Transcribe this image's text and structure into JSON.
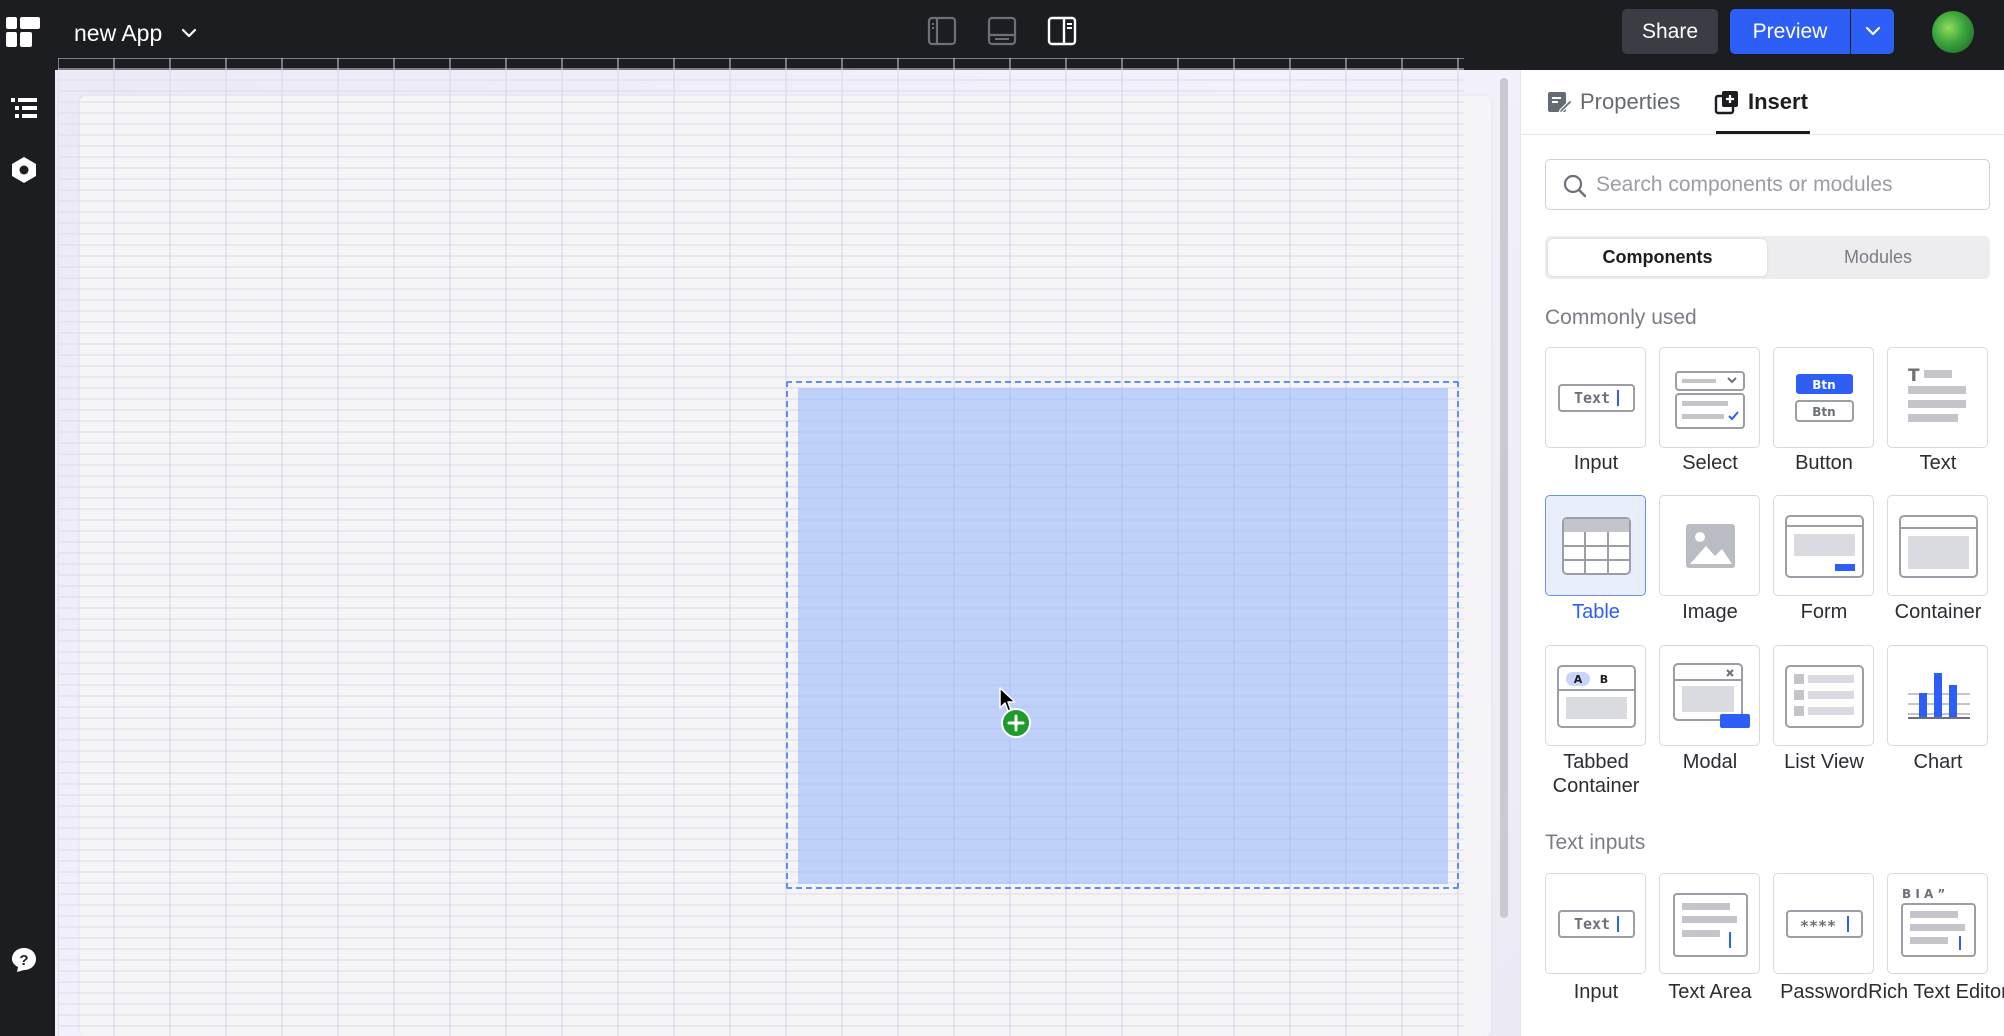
{
  "app": {
    "name": "new App"
  },
  "header": {
    "share_label": "Share",
    "preview_label": "Preview"
  },
  "panel": {
    "tabs": [
      {
        "label": "Properties"
      },
      {
        "label": "Insert"
      }
    ],
    "search": {
      "placeholder": "Search components or modules",
      "value": ""
    },
    "segments": [
      {
        "label": "Components"
      },
      {
        "label": "Modules"
      }
    ],
    "sections": [
      {
        "title": "Commonly used",
        "items": [
          {
            "label": "Input",
            "icon": "input-icon"
          },
          {
            "label": "Select",
            "icon": "select-icon"
          },
          {
            "label": "Button",
            "icon": "button-icon"
          },
          {
            "label": "Text",
            "icon": "text-icon"
          },
          {
            "label": "Table",
            "icon": "table-icon",
            "selected": true
          },
          {
            "label": "Image",
            "icon": "image-icon"
          },
          {
            "label": "Form",
            "icon": "form-icon"
          },
          {
            "label": "Container",
            "icon": "container-icon"
          },
          {
            "label": "Tabbed Container",
            "icon": "tabbed-container-icon"
          },
          {
            "label": "Modal",
            "icon": "modal-icon"
          },
          {
            "label": "List View",
            "icon": "list-view-icon"
          },
          {
            "label": "Chart",
            "icon": "chart-icon"
          }
        ]
      },
      {
        "title": "Text inputs",
        "items": [
          {
            "label": "Input",
            "icon": "text-input-icon"
          },
          {
            "label": "Text Area",
            "icon": "text-area-icon"
          },
          {
            "label": "Password",
            "icon": "password-icon"
          },
          {
            "label": "Rich Text Editor",
            "icon": "rich-text-editor-icon"
          }
        ]
      }
    ],
    "icon_texts": {
      "input": "Text",
      "button_primary": "Btn",
      "button_secondary": "Btn",
      "tab_a": "A",
      "tab_b": "B",
      "password": "****",
      "rte_toolbar": "B I A ”"
    }
  },
  "colors": {
    "topbar": "#1c1d20",
    "accent": "#2d5ef5",
    "drop_zone": "#92b2fc",
    "add_badge": "#1f9b2c"
  }
}
